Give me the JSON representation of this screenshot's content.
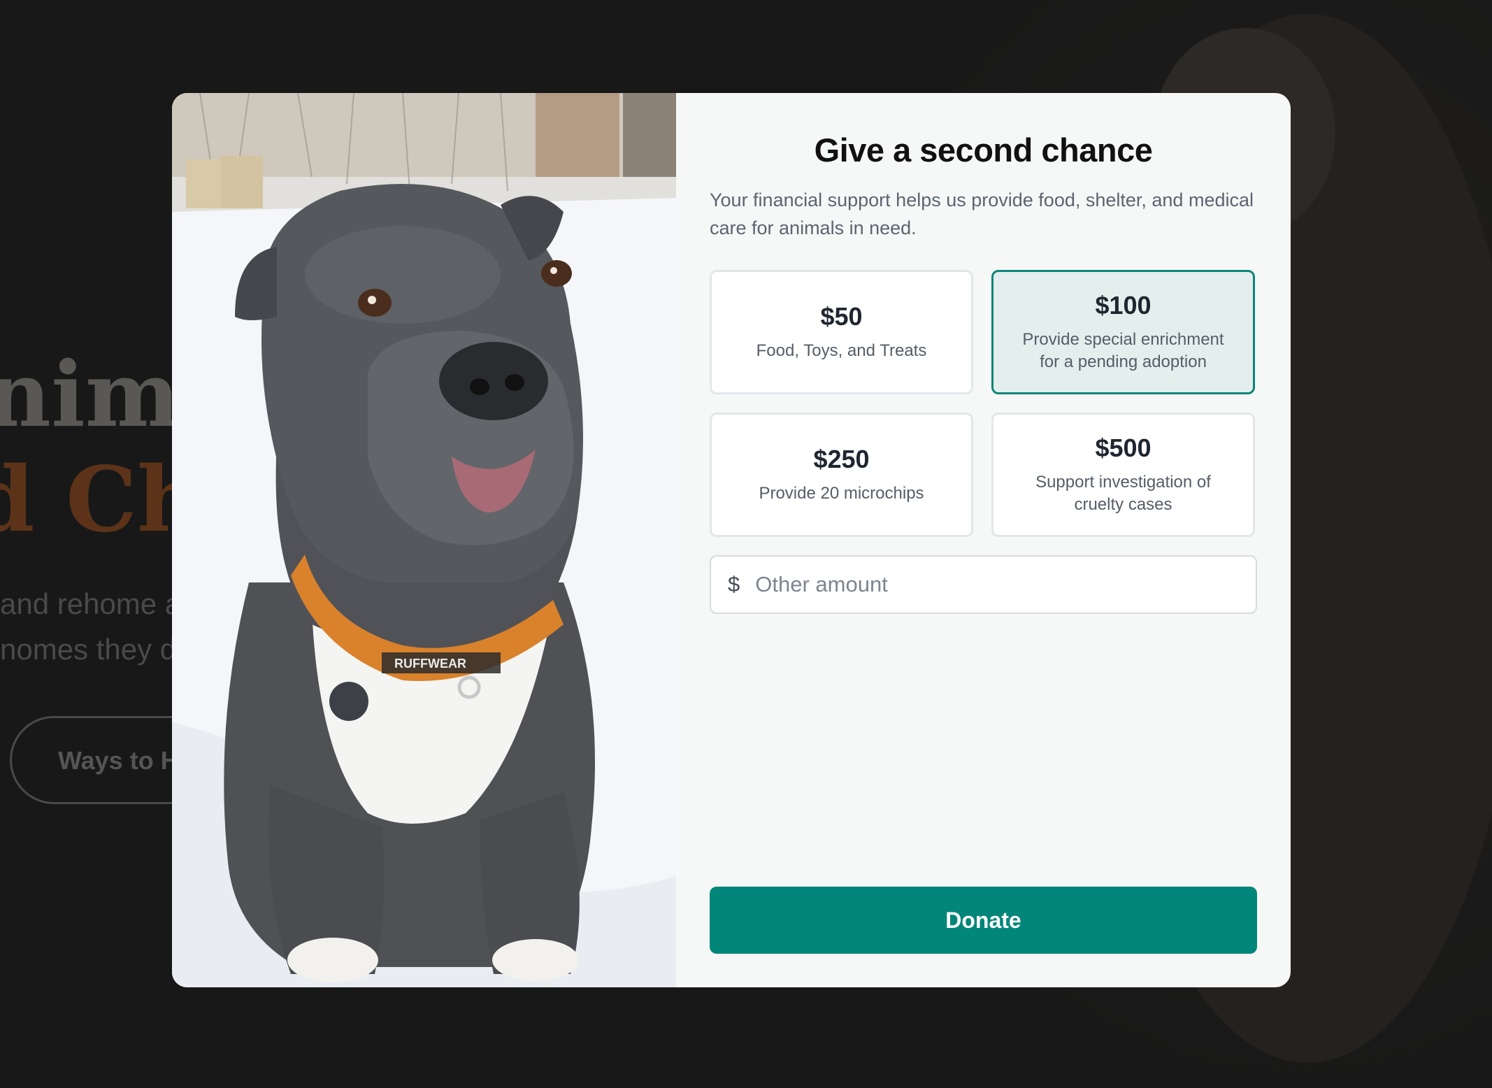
{
  "background": {
    "hero_line1": "nimal",
    "hero_line2": "d Cha",
    "hero_para_line1": "and rehome a",
    "hero_para_line2": "nomes they de",
    "hero_button": "Ways to H"
  },
  "modal": {
    "photo_alt": "Gray and white pit bull dog with an orange collar sitting in the snow",
    "collar_text": "RUFFWEAR",
    "title": "Give a second chance",
    "subtitle": "Your financial support helps us provide food, shelter, and medical care for animals in need.",
    "options": [
      {
        "amount": "$50",
        "description": "Food, Toys, and Treats",
        "selected": false
      },
      {
        "amount": "$100",
        "description": "Provide special enrichment for a pending adoption",
        "selected": true
      },
      {
        "amount": "$250",
        "description": "Provide 20 microchips",
        "selected": false
      },
      {
        "amount": "$500",
        "description": "Support investigation of cruelty cases",
        "selected": false
      }
    ],
    "other_amount": {
      "currency_symbol": "$",
      "placeholder": "Other amount",
      "value": ""
    },
    "donate_label": "Donate"
  },
  "colors": {
    "accent": "#02867a",
    "selected_bg": "#e4efed",
    "hero_accent": "#5c3319"
  }
}
